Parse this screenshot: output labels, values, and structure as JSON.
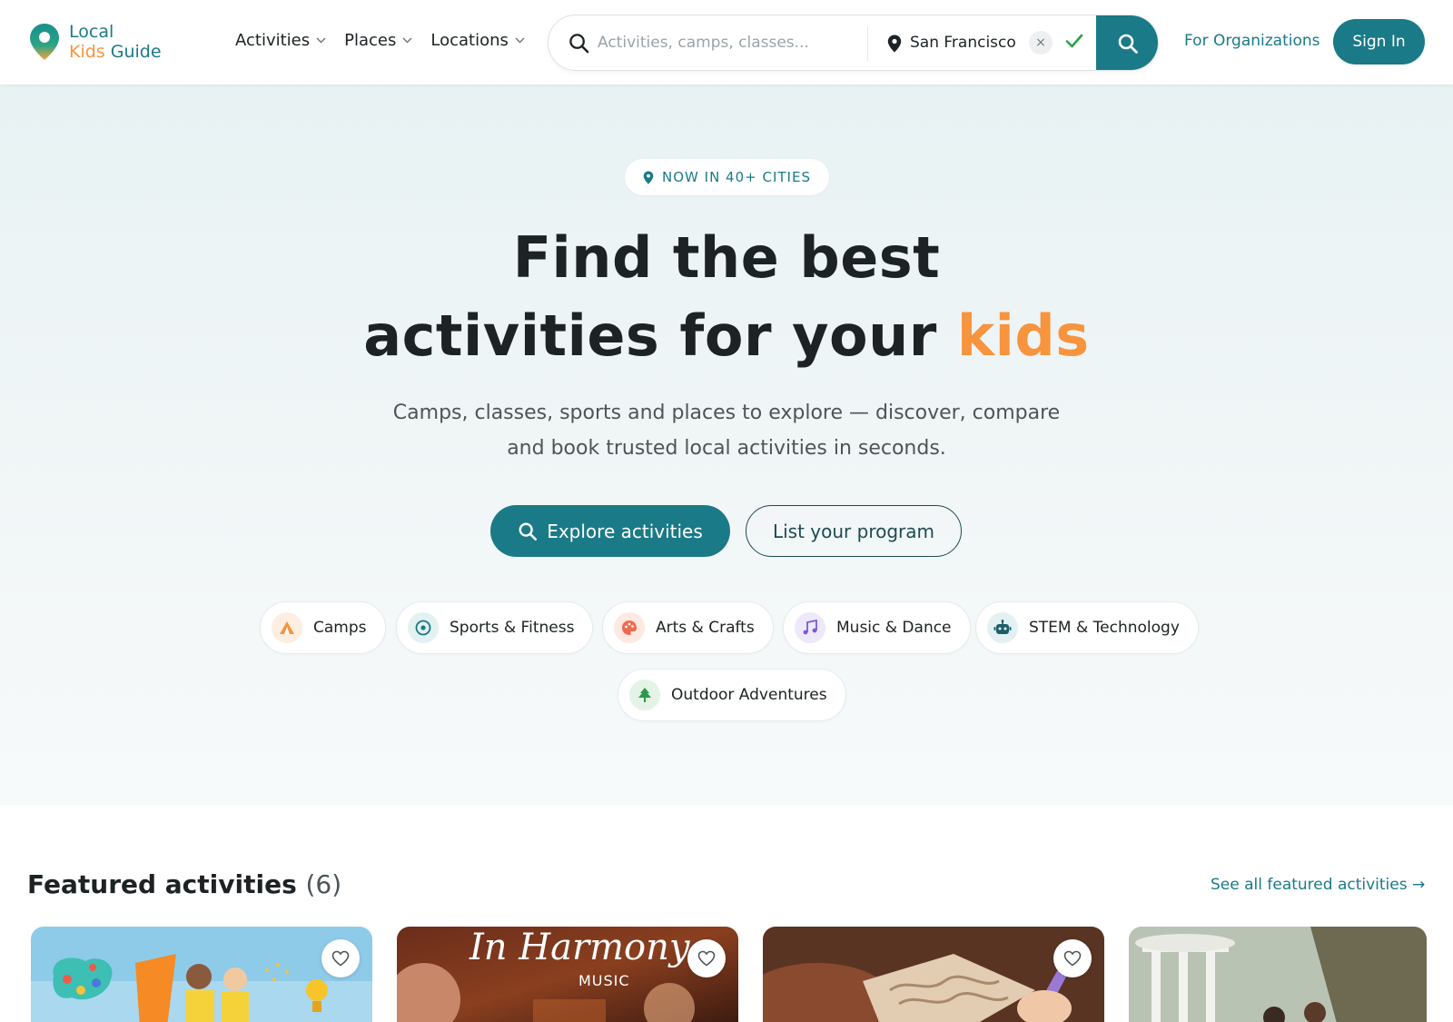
{
  "brand": {
    "line1": "Local",
    "line2_kids": "Kids",
    "line2_guide": " Guide",
    "primary_color": "#1a7a87",
    "accent_color": "#f7943d"
  },
  "nav": {
    "items": [
      {
        "label": "Activities",
        "icon": "chevron-down-icon"
      },
      {
        "label": "Places",
        "icon": "chevron-down-icon"
      },
      {
        "label": "Locations",
        "icon": "chevron-down-icon"
      }
    ]
  },
  "search": {
    "placeholder": "Activities, camps, classes...",
    "location_value": "San Francisco",
    "clear_label": "×"
  },
  "header_actions": {
    "for_organizations": "For Organizations",
    "sign_in": "Sign In"
  },
  "hero": {
    "badge": "NOW IN 40+ CITIES",
    "title_line1": "Find the best",
    "title_line2_main": "activities for your ",
    "title_line2_accent": "kids",
    "subtitle_line1": "Camps, classes, sports and places to explore — discover, compare",
    "subtitle_line2": "and book trusted local activities in seconds.",
    "cta_primary": "Explore activities",
    "cta_secondary": "List your program"
  },
  "categories": [
    {
      "label": "Camps",
      "icon": "tent-icon"
    },
    {
      "label": "Sports & Fitness",
      "icon": "ball-icon"
    },
    {
      "label": "Arts & Crafts",
      "icon": "palette-icon"
    },
    {
      "label": "Music & Dance",
      "icon": "music-note-icon"
    },
    {
      "label": "STEM & Technology",
      "icon": "robot-icon"
    },
    {
      "label": "Outdoor Adventures",
      "icon": "tree-icon"
    }
  ],
  "featured": {
    "title": "Featured activities",
    "count": "(6)",
    "see_all": "See all featured activities →",
    "card2_logo": "In Harmony",
    "card2_logo_sub": "MUSIC"
  }
}
